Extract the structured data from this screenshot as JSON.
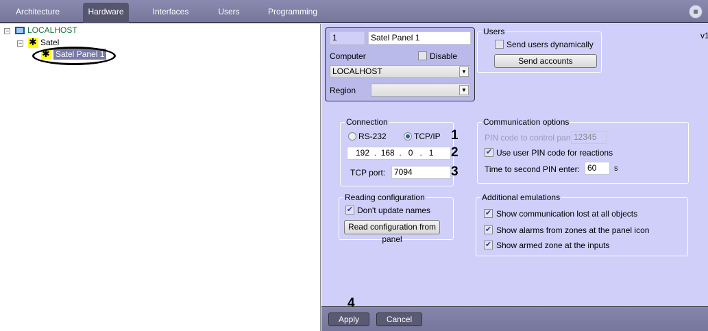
{
  "tabs": [
    {
      "label": "Architecture"
    },
    {
      "label": "Hardware",
      "active": true
    },
    {
      "label": "Interfaces"
    },
    {
      "label": "Users"
    },
    {
      "label": "Programming"
    }
  ],
  "tree": {
    "root": "LOCALHOST",
    "child": "Satel",
    "selected": "Satel Panel 1"
  },
  "version": "v1",
  "object": {
    "id": "1",
    "name": "Satel Panel 1",
    "computer_label": "Computer",
    "disable_label": "Disable",
    "disable_checked": false,
    "computer_value": "LOCALHOST",
    "region_label": "Region",
    "region_value": ""
  },
  "users": {
    "title": "Users",
    "send_dynamic": "Send users dynamically",
    "send_dynamic_checked": false,
    "send_accounts": "Send accounts"
  },
  "connection": {
    "title": "Connection",
    "rs232": "RS-232",
    "tcpip": "TCP/IP",
    "selected": "TCP/IP",
    "ip": [
      "192",
      "168",
      "0",
      "1"
    ],
    "port_label": "TCP port:",
    "port": "7094"
  },
  "comm": {
    "title": "Communication options",
    "pin_label": "PIN code to control panel:",
    "pin": "12345",
    "use_pin": "Use user PIN code for reactions",
    "use_pin_checked": true,
    "time_label": "Time to second PIN enter:",
    "time": "60",
    "time_unit": "s"
  },
  "reading": {
    "title": "Reading configuration",
    "dont_update": "Don't update names",
    "dont_update_checked": true,
    "read_button": "Read configuration from panel"
  },
  "emulations": {
    "title": "Additional emulations",
    "items": [
      {
        "label": "Show communication lost at all objects",
        "checked": true
      },
      {
        "label": "Show alarms from zones at the panel icon",
        "checked": true
      },
      {
        "label": "Show armed zone at the inputs",
        "checked": true
      }
    ]
  },
  "annotations": [
    "1",
    "2",
    "3",
    "4"
  ],
  "footer": {
    "apply": "Apply",
    "cancel": "Cancel"
  }
}
